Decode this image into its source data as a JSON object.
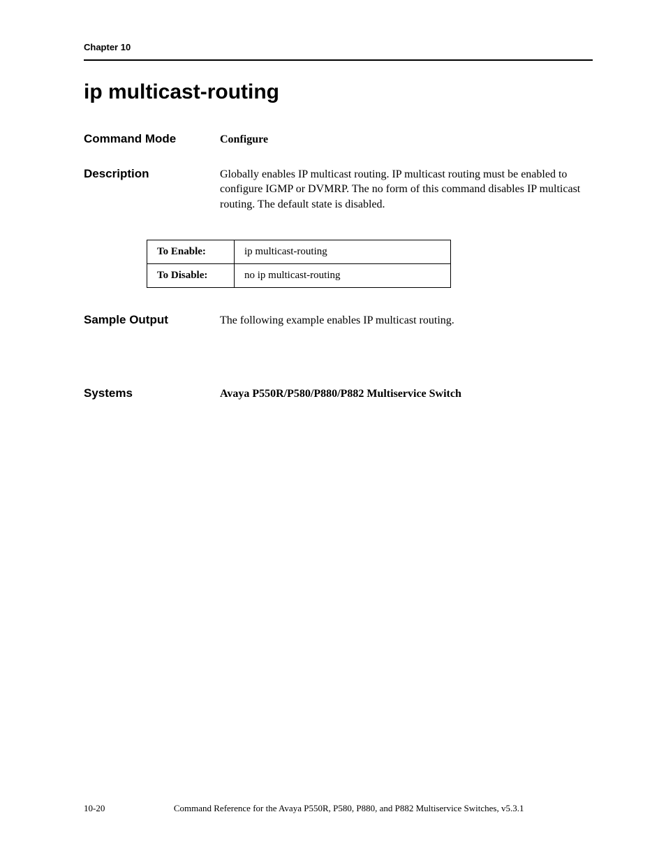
{
  "header": {
    "chapter": "Chapter 10"
  },
  "title": "ip multicast-routing",
  "sections": {
    "command_mode": {
      "label": "Command Mode",
      "value": "Configure"
    },
    "description": {
      "label": "Description",
      "value": "Globally enables IP multicast routing. IP multicast routing must be enabled to configure IGMP or DVMRP. The no form of this command disables IP multicast routing. The default state is disabled."
    },
    "sample_output": {
      "label": "Sample Output",
      "value": "The following example enables IP multicast routing."
    },
    "systems": {
      "label": "Systems",
      "value": "Avaya P550R/P580/P880/P882 Multiservice Switch"
    }
  },
  "table": {
    "rows": [
      {
        "label": "To Enable:",
        "value": "ip multicast-routing"
      },
      {
        "label": "To Disable:",
        "value": "no ip multicast-routing"
      }
    ]
  },
  "footer": {
    "page": "10-20",
    "title": "Command Reference for the Avaya P550R, P580, P880, and P882 Multiservice Switches, v5.3.1"
  }
}
